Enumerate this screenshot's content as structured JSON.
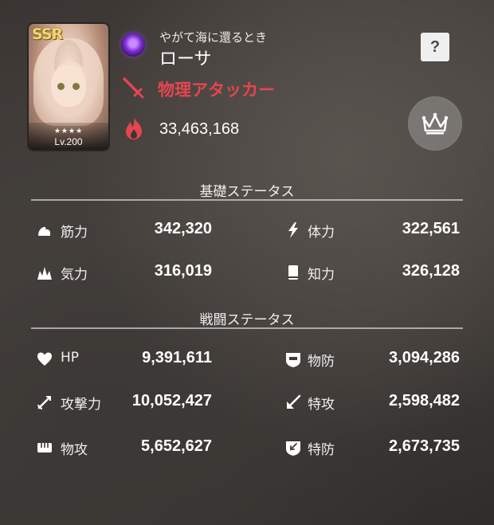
{
  "character": {
    "rarity": "SSR",
    "stars": "★★★★",
    "level": "Lv.200",
    "subtitle": "やがて海に還るとき",
    "name": "ローサ",
    "role": "物理アタッカー",
    "power": "33,463,168",
    "element_icon": "purple-orb-icon",
    "role_color": "#e5454f"
  },
  "buttons": {
    "help_label": "?"
  },
  "base_stats": {
    "title": "基礎ステータス",
    "left": [
      {
        "label": "筋力",
        "value": "342,320",
        "icon": "arm-icon"
      },
      {
        "label": "気力",
        "value": "316,019",
        "icon": "spirit-icon"
      }
    ],
    "right": [
      {
        "label": "体力",
        "value": "322,561",
        "icon": "lightning-icon"
      },
      {
        "label": "知力",
        "value": "326,128",
        "icon": "book-icon"
      }
    ]
  },
  "battle_stats": {
    "title": "戦闘ステータス",
    "left": [
      {
        "label": "HP",
        "value": "9,391,611",
        "icon": "heart-icon"
      },
      {
        "label": "攻撃力",
        "value": "10,052,427",
        "icon": "sword-icon"
      },
      {
        "label": "物攻",
        "value": "5,652,627",
        "icon": "fist-icon"
      }
    ],
    "right": [
      {
        "label": "物防",
        "value": "3,094,286",
        "icon": "shield-icon"
      },
      {
        "label": "特攻",
        "value": "2,598,482",
        "icon": "magic-arrow-icon"
      },
      {
        "label": "特防",
        "value": "2,673,735",
        "icon": "magic-shield-icon"
      }
    ]
  }
}
